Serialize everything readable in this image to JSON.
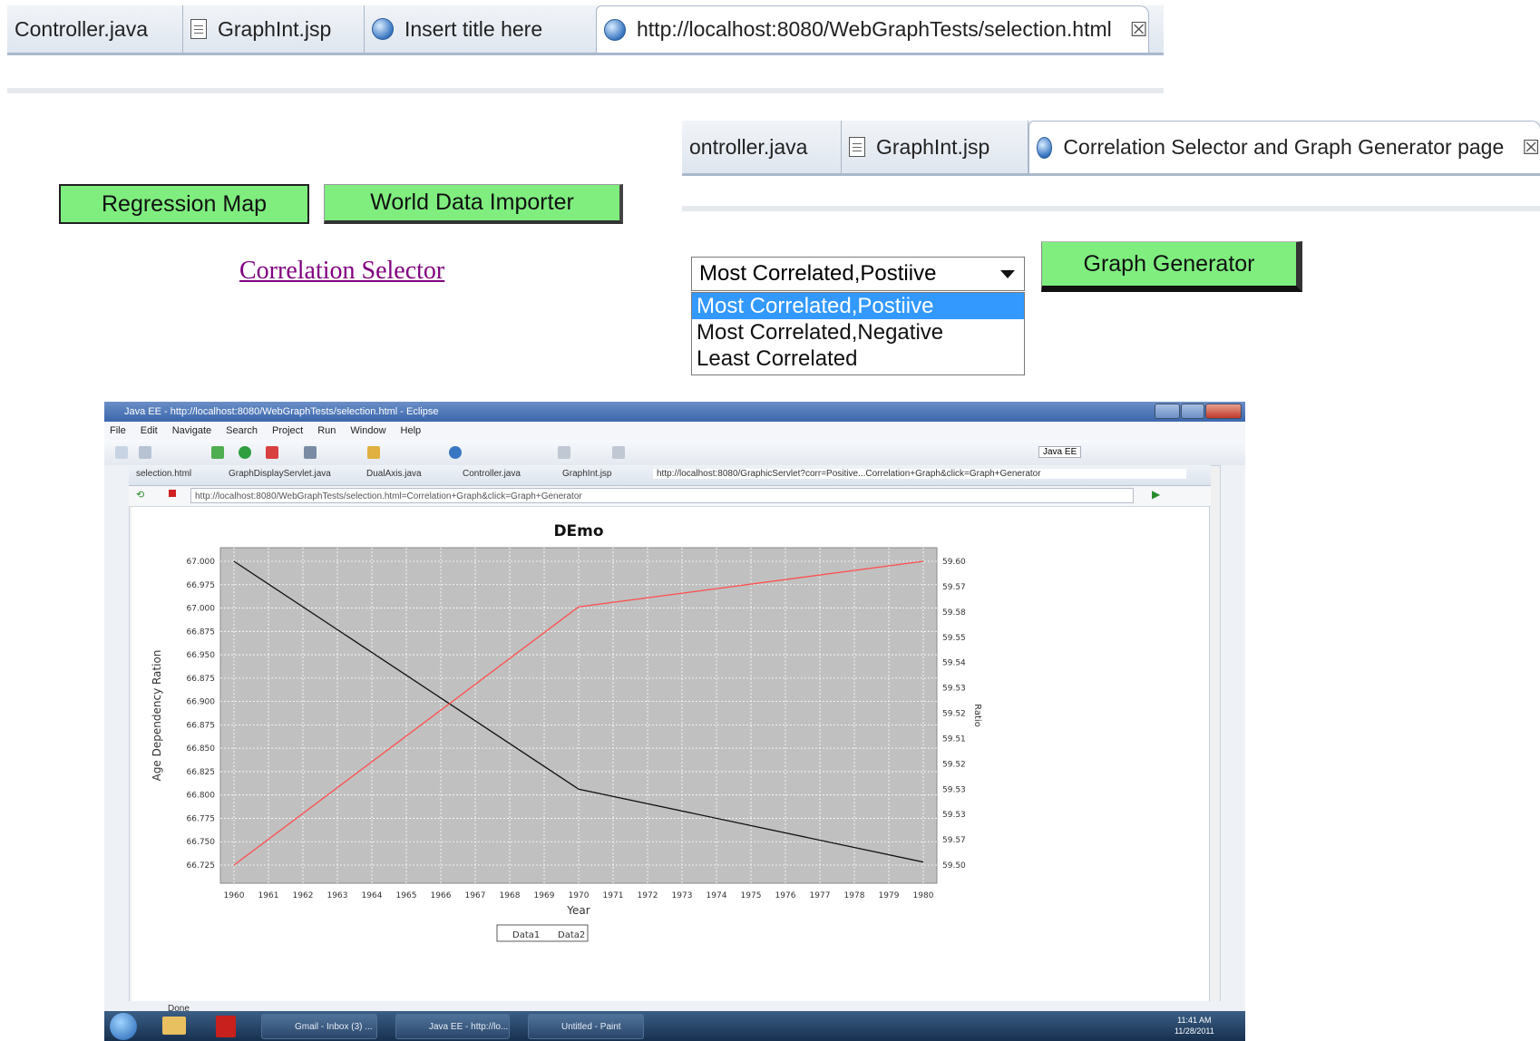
{
  "top_tabs": [
    {
      "label": "Controller.java",
      "icon": "none"
    },
    {
      "label": "GraphInt.jsp",
      "icon": "jsp-file-icon"
    },
    {
      "label": "Insert title here",
      "icon": "globe-icon"
    },
    {
      "label": "http://localhost:8080/WebGraphTests/selection.html",
      "icon": "globe-icon",
      "active": true
    }
  ],
  "buttons": {
    "regression_map": "Regression Map",
    "world_data_importer": "World Data Importer",
    "graph_generator": "Graph Generator"
  },
  "correlation_link": "Correlation Selector",
  "second_tabs": [
    {
      "label": "ontroller.java"
    },
    {
      "label": "GraphInt.jsp"
    },
    {
      "label": "Correlation Selector and Graph Generator page",
      "active": true
    }
  ],
  "select": {
    "value": "Most Correlated,Postiive",
    "options": [
      "Most Correlated,Postiive",
      "Most Correlated,Negative",
      "Least Correlated"
    ]
  },
  "eclipse_window": {
    "title": "Java EE - http://localhost:8080/WebGraphTests/selection.html - Eclipse",
    "menu": [
      "File",
      "Edit",
      "Navigate",
      "Search",
      "Project",
      "Run",
      "Window",
      "Help"
    ],
    "perspective": "Java EE",
    "editor_tabs": [
      "selection.html",
      "GraphDisplayServlet.java",
      "DualAxis.java",
      "Controller.java",
      "GraphInt.jsp",
      "http://localhost:8080/GraphicServlet?corr=Positive...Correlation+Graph&click=Graph+Generator"
    ],
    "address": "http://localhost:8080/WebGraphTests/selection.html",
    "address_suffix": "=Correlation+Graph&click=Graph+Generator",
    "status": "Done",
    "taskbar": [
      "Gmail - Inbox (3) ...",
      "Java EE - http://lo...",
      "Untitled - Paint"
    ],
    "clock": {
      "time": "11:41 AM",
      "date": "11/28/2011"
    }
  },
  "chart_data": {
    "type": "line",
    "title": "DEmo",
    "xlabel": "Year",
    "ylabel": "Age Dependency Ration",
    "y2label": "Ratio",
    "x": [
      1960,
      1961,
      1962,
      1963,
      1964,
      1965,
      1966,
      1967,
      1968,
      1969,
      1970,
      1971,
      1972,
      1973,
      1974,
      1975,
      1976,
      1977,
      1978,
      1979,
      1980
    ],
    "x_tick_labels": [
      "1960",
      "1961",
      "1962",
      "1963",
      "1964",
      "1965",
      "1966",
      "1967",
      "1968",
      "1969",
      "1970",
      "1971",
      "1972",
      "1973",
      "1974",
      "1975",
      "1976",
      "1977",
      "1978",
      "1979",
      "1980"
    ],
    "y_ticks": [
      "67.000",
      "66.975",
      "67.000",
      "66.875",
      "66.950",
      "66.875",
      "66.900",
      "66.875",
      "66.850",
      "66.825",
      "66.800",
      "66.775",
      "66.750",
      "66.725"
    ],
    "y2_ticks": [
      "59.60",
      "59.57",
      "59.58",
      "59.55",
      "59.54",
      "59.53",
      "59.52",
      "59.51",
      "59.52",
      "59.53",
      "59.53",
      "59.57",
      "59.50"
    ],
    "series": [
      {
        "name": "Data1",
        "color": "#111111",
        "points": [
          [
            1960,
            1.0
          ],
          [
            1970,
            0.25
          ],
          [
            1980,
            0.01
          ]
        ]
      },
      {
        "name": "Data2",
        "color": "#ff4d4d",
        "points": [
          [
            1960,
            0.0
          ],
          [
            1970,
            0.85
          ],
          [
            1980,
            1.0
          ]
        ]
      }
    ],
    "legend": [
      "Data1",
      "Data2"
    ],
    "grid": true,
    "plot_background": "#c0c0c0"
  },
  "colors": {
    "button_green": "#7fee7f",
    "link_purple": "#800080",
    "highlight_blue": "#3399ff"
  }
}
